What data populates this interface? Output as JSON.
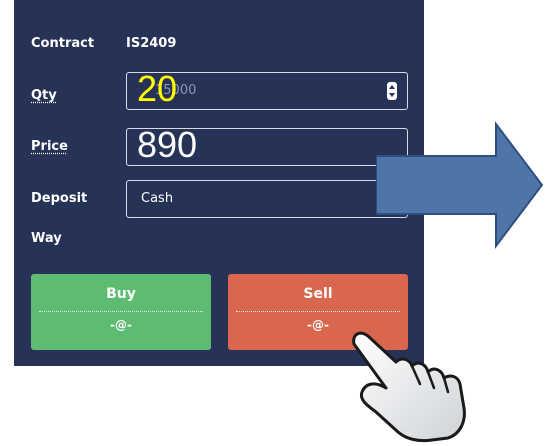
{
  "form": {
    "contract": {
      "label": "Contract",
      "value": "IS2409"
    },
    "qty": {
      "label": "Qty",
      "placeholder": "15000",
      "value": "20",
      "value_color": "#ffff00"
    },
    "price": {
      "label": "Price",
      "value": "890",
      "value_color": "#ffffff"
    },
    "deposit": {
      "label_line1": "Deposit",
      "label_line2": "Way",
      "selected": "Cash"
    }
  },
  "buttons": {
    "buy": {
      "label": "Buy",
      "sub": "-@-",
      "color": "#5dbb72"
    },
    "sell": {
      "label": "Sell",
      "sub": "-@-",
      "color": "#d9664e"
    }
  },
  "panel_color": "#263357",
  "overlay": {
    "arrow_icon": "right-arrow-icon",
    "arrow_color": "#4f74a8",
    "cursor_icon": "pointing-hand-cursor-icon"
  }
}
